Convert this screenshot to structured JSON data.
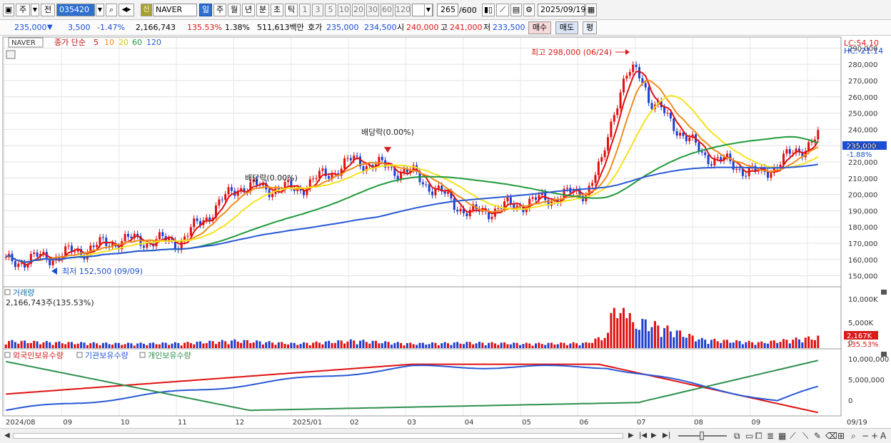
{
  "toolbar": {
    "type_label": "주",
    "prev_label": "전",
    "code": "035420",
    "name_badge": "신",
    "stock_name": "NAVER",
    "periods": [
      "일",
      "주",
      "월",
      "년",
      "분",
      "초",
      "틱"
    ],
    "period_selected": "일",
    "intervals": [
      "1",
      "3",
      "5",
      "10",
      "20",
      "30",
      "60",
      "120"
    ],
    "count_value": "265",
    "count_max": "/600",
    "date": "2025/09/19"
  },
  "quote": {
    "price": "235,000",
    "change": "3,500",
    "change_pct": "-1.47%",
    "volume": "2,166,743",
    "vol_ratio": "135.53%",
    "turnover": "1.38%",
    "amount": "511,613백만",
    "hoga_label": "호가",
    "ask": "235,000",
    "bid": "234,500",
    "open_label": "시",
    "open": "240,000",
    "high_label": "고",
    "high": "241,000",
    "low_label": "저",
    "low": "233,500",
    "buy_label": "매수",
    "sell_label": "매도",
    "eval_label": "평"
  },
  "price_panel": {
    "stock_tag": "NAVER",
    "legend_main": "종가 단순",
    "legend_periods": [
      "5",
      "10",
      "20",
      "60",
      "120"
    ],
    "lc": "LC:54.10",
    "hc": "HC:-21.14",
    "current_price_tag": "235,000",
    "current_change_tag": "-1.88%",
    "high_note": "최고 298,000 (06/24)",
    "low_note": "최저 152,500 (09/09)",
    "dividend_note_1": "배당락(0.00%)",
    "dividend_note_2": "배당락(0.00%)",
    "y_ticks": [
      "290,000",
      "280,000",
      "270,000",
      "260,000",
      "250,000",
      "240,000",
      "230,000",
      "220,000",
      "210,000",
      "200,000",
      "190,000",
      "180,000",
      "170,000",
      "160,000",
      "150,000"
    ]
  },
  "volume_panel": {
    "title": "거래량",
    "value": "2,166,743주(135.53%)",
    "y_ticks": [
      "10,000K",
      "5,000K",
      "0"
    ],
    "current_tag": "2,167K",
    "current_pct": "135.53%"
  },
  "holding_panel": {
    "legend": [
      "외국인보유수량",
      "기관보유수량",
      "개인보유수량"
    ],
    "y_ticks": [
      "10,000,000",
      "5,000,000",
      "0"
    ]
  },
  "x_axis": [
    "2024/08",
    "09",
    "10",
    "11",
    "12",
    "2025/01",
    "02",
    "03",
    "04",
    "05",
    "06",
    "07",
    "08",
    "09",
    "09/19"
  ],
  "colors": {
    "ma5": "#e01010",
    "ma10": "#f28c1a",
    "ma20": "#f5e21c",
    "ma60": "#1f9a3a",
    "ma120": "#2858d6",
    "up": "#e01010",
    "down": "#1f3fcf",
    "foreign": "#e01010",
    "institution": "#2858d6",
    "individual": "#2d8f4e"
  },
  "chart_data": {
    "type": "line",
    "x": [
      "2024/08",
      "2024/09",
      "2024/10",
      "2024/11",
      "2024/12",
      "2025/01",
      "2025/02",
      "2025/03",
      "2025/04",
      "2025/05",
      "2025/06",
      "2025/07",
      "2025/08",
      "2025/09",
      "2025/09/19"
    ],
    "series": [
      {
        "name": "종가",
        "values": [
          158000,
          163000,
          172000,
          171000,
          205000,
          203000,
          221000,
          213000,
          188000,
          195000,
          202000,
          262000,
          225000,
          212000,
          235000
        ]
      },
      {
        "name": "거래량",
        "values": [
          1400,
          1100,
          900,
          1000,
          1500,
          900,
          1500,
          900,
          1100,
          900,
          1000,
          5200,
          1700,
          1100,
          2167
        ]
      }
    ],
    "y_range": [
      145000,
      295000
    ],
    "high": 298000,
    "low": 152500
  }
}
